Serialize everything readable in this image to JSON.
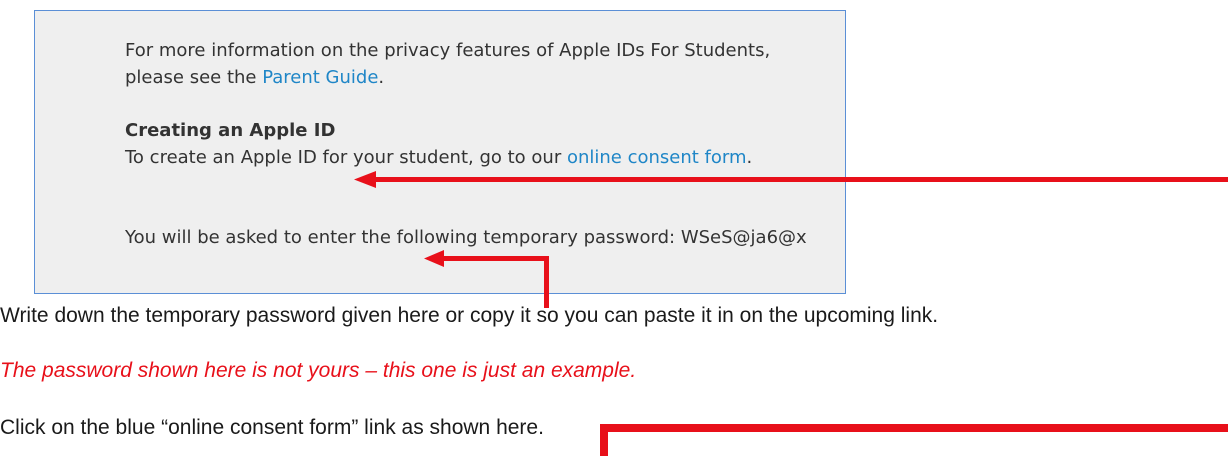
{
  "info_box": {
    "intro_text": "For more information on the privacy features of Apple IDs For Students, please see the ",
    "parent_guide_link": "Parent Guide",
    "intro_end": ".",
    "heading": "Creating an Apple ID",
    "create_text": "To create an Apple ID for your student, go to our ",
    "consent_link": "online consent form",
    "create_end": ".",
    "password_prompt": "You will be asked to enter the following temporary password: ",
    "password_value": "WSeS@ja6@x"
  },
  "doc": {
    "instruction": "Write down the temporary password given here or copy it so you can paste it in on the upcoming link.",
    "note": "The password shown here is not yours – this one is just an example.",
    "click_instruction": "Click on the blue “online consent form” link as shown here."
  },
  "colors": {
    "link": "#1f86c7",
    "arrow": "#e8101a",
    "note": "#e8101a",
    "box_border": "#5b8fd6",
    "box_background": "#efefef"
  }
}
